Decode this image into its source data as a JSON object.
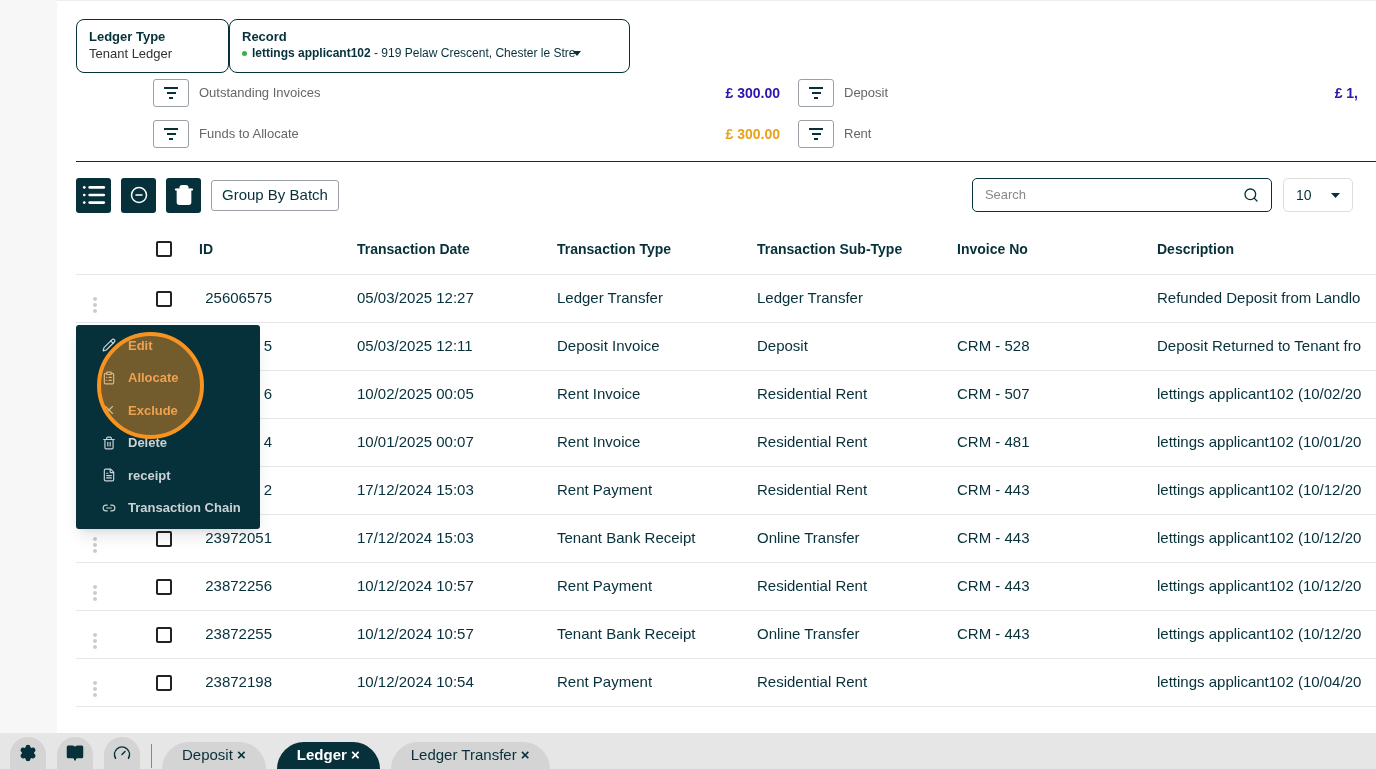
{
  "filters": {
    "ledger_type": {
      "label": "Ledger Type",
      "value": "Tenant Ledger"
    },
    "record": {
      "label": "Record",
      "name": "lettings applicant102",
      "address": " - 919 Pelaw Crescent, Chester le Stre"
    }
  },
  "summary": [
    {
      "label": "Outstanding Invoices",
      "amount": "£ 300.00",
      "color": "#2a15b0"
    },
    {
      "label": "Deposit",
      "amount": "£ 1,",
      "color": "#2a15b0"
    },
    {
      "label": "Funds to Allocate",
      "amount": "£ 300.00",
      "color": "#e8a21c"
    },
    {
      "label": "Rent"
    }
  ],
  "toolbar": {
    "group_button": "Group By Batch",
    "search_placeholder": "Search",
    "page_size": "10"
  },
  "table": {
    "select_all_checked": false,
    "columns": [
      "ID",
      "Transaction Date",
      "Transaction Type",
      "Transaction Sub-Type",
      "Invoice No",
      "Description"
    ],
    "rows": [
      {
        "id": "25606575",
        "date": "05/03/2025 12:27",
        "type": "Ledger Transfer",
        "subtype": "Ledger Transfer",
        "invoice": "",
        "description": "Refunded Deposit from Landlo",
        "checked": false
      },
      {
        "id": "5",
        "date": "05/03/2025 12:11",
        "type": "Deposit Invoice",
        "subtype": "Deposit",
        "invoice": "CRM - 528",
        "description": "Deposit Returned to Tenant fro"
      },
      {
        "id": "6",
        "date": "10/02/2025 00:05",
        "type": "Rent Invoice",
        "subtype": "Residential Rent",
        "invoice": "CRM - 507",
        "description": "lettings applicant102 (10/02/20"
      },
      {
        "id": "4",
        "date": "10/01/2025 00:07",
        "type": "Rent Invoice",
        "subtype": "Residential Rent",
        "invoice": "CRM - 481",
        "description": "lettings applicant102 (10/01/20"
      },
      {
        "id": "2",
        "date": "17/12/2024 15:03",
        "type": "Rent Payment",
        "subtype": "Residential Rent",
        "invoice": "CRM - 443",
        "description": "lettings applicant102 (10/12/20"
      },
      {
        "id": "23972051",
        "date": "17/12/2024 15:03",
        "type": "Tenant Bank Receipt",
        "subtype": "Online Transfer",
        "invoice": "CRM - 443",
        "description": "lettings applicant102 (10/12/20",
        "checked": false
      },
      {
        "id": "23872256",
        "date": "10/12/2024 10:57",
        "type": "Rent Payment",
        "subtype": "Residential Rent",
        "invoice": "CRM - 443",
        "description": "lettings applicant102 (10/12/20",
        "checked": false
      },
      {
        "id": "23872255",
        "date": "10/12/2024 10:57",
        "type": "Tenant Bank Receipt",
        "subtype": "Online Transfer",
        "invoice": "CRM - 443",
        "description": "lettings applicant102 (10/12/20",
        "checked": false
      },
      {
        "id": "23872198",
        "date": "10/12/2024 10:54",
        "type": "Rent Payment",
        "subtype": "Residential Rent",
        "invoice": "",
        "description": "lettings applicant102 (10/04/20",
        "checked": false
      }
    ]
  },
  "context_menu": [
    {
      "label": "Edit",
      "highlighted": true
    },
    {
      "label": "Allocate",
      "highlighted": true
    },
    {
      "label": "Exclude",
      "highlighted": true
    },
    {
      "label": "Delete",
      "highlighted": false
    },
    {
      "label": "receipt",
      "highlighted": false
    },
    {
      "label": "Transaction Chain",
      "highlighted": false
    }
  ],
  "bottom_tabs": [
    {
      "label": "Deposit",
      "close": "×",
      "selected": false
    },
    {
      "label": "Ledger",
      "close": "×",
      "selected": true
    },
    {
      "label": "Ledger Transfer",
      "close": "×",
      "selected": false
    }
  ]
}
